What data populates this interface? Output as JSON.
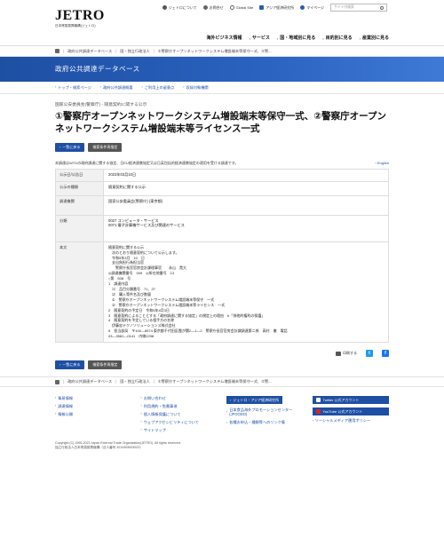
{
  "header": {
    "logo_text": "JETRO",
    "logo_sub": "日本貿易振興機構(ジェトロ)",
    "util_links": [
      "ジェトロについて",
      "お問合せ",
      "Global Site",
      "アジア経済研究所"
    ],
    "mypage": "マイページ",
    "search_placeholder": "サイト内検索",
    "gnav": [
      "海外ビジネス情報",
      "サービス",
      "国・地域別に見る",
      "目的別に見る",
      "産業別に見る"
    ]
  },
  "breadcrumb": [
    "政府公共調達データベース",
    "国・独立行政法人",
    "①警察庁オープンネットワークシステム増設端末等保守一式、②警..."
  ],
  "banner": {
    "title": "政府公共調達データベース"
  },
  "subnav": [
    "トップ・検索ページ",
    "政府公共調達概要",
    "ご利用上の留意点",
    "収録対象機関"
  ],
  "main": {
    "kicker": "国家公安委員会(警察庁) - 随意契約に関する公示",
    "title": "①警察庁オープンネットワークシステム増設端末等保守一式、②警察庁オープンネットワークシステム増設端末等ライセンス一式",
    "btn_back": "一覧に戻る",
    "btn_clear": "検索条件再指定",
    "note": "本調達はWTOの政府調達に関する協定、日EU経済連携協定又は日英包括的経済連携協定の適用を受ける調達です。",
    "english": "English"
  },
  "info_table": {
    "rows": [
      {
        "label": "公示日/公告日",
        "value": "2023年03月10日"
      },
      {
        "label": "公示の種類",
        "value": "随意契約に関する公示"
      },
      {
        "label": "調達機関",
        "value": "国家公安委員会(警察庁) (東京都)"
      },
      {
        "label": "分類",
        "value": "0027 コンピュータ・サービス\n0071 電子計算機サービス及び関連のサービス"
      },
      {
        "label": "本文",
        "value": "随意契約に関する公示\n　次のとおり随意契約について公示します。\n　令和5年3月　10　日\n　支出負担行為担当官\n　　警察庁長官官房会計課理事官　　永山　貴大\n◎調達機関番号　009　◎所在地番号　13\n○第　508　号\n1　調達内容\n　⑴　品目分類番号　71、27\n　⑵　購入等件名及び数量\n　①　警察庁オープンネットワークシステム増設端末等保守　一式\n　②　警察庁オープンネットワークシステム増設端末等ライセンス　一式\n2　随意契約の予定日　令和5年4月3日\n3　随意契約によることとする「政府調達に関する協定」の規定上の理由　b「排他的権利の保護」\n4　随意契約を予定している相手方の名称\n　伊藤忠テクノソリューションズ株式会社\n5　担当部局　〒100―8974 東京都千代田区霞が関2―1―2　警察庁長官官房会計課調達第二係　高村　徹　電話\n03―3581―0141　内線2298"
      }
    ]
  },
  "share": {
    "print": "印刷する"
  },
  "footer": {
    "col1": [
      "貿易情報",
      "調達情報",
      "情報公開"
    ],
    "col2": [
      "お問い合わせ",
      "利用規約・免責事項",
      "個人情報保護について",
      "ウェブアクセシビリティについて",
      "サイトマップ"
    ],
    "col3_box": "ジェトロ・アジア経済研究所",
    "col3": [
      "日本食品海外プロモーションセンター(JFOODO)",
      "各種お申込・種類等へのリンク集"
    ],
    "col4": [
      "Twitter 公式アカウント",
      "YouTube 公式アカウント",
      "ソーシャルメディア運用ポリシー"
    ]
  },
  "copyright": [
    "Copyright (C) 1995-2023 Japan External Trade Organization(JETRO). All rights reserved.",
    "独立行政法人日本貿易振興機構（法人番号 2010405003023）"
  ]
}
